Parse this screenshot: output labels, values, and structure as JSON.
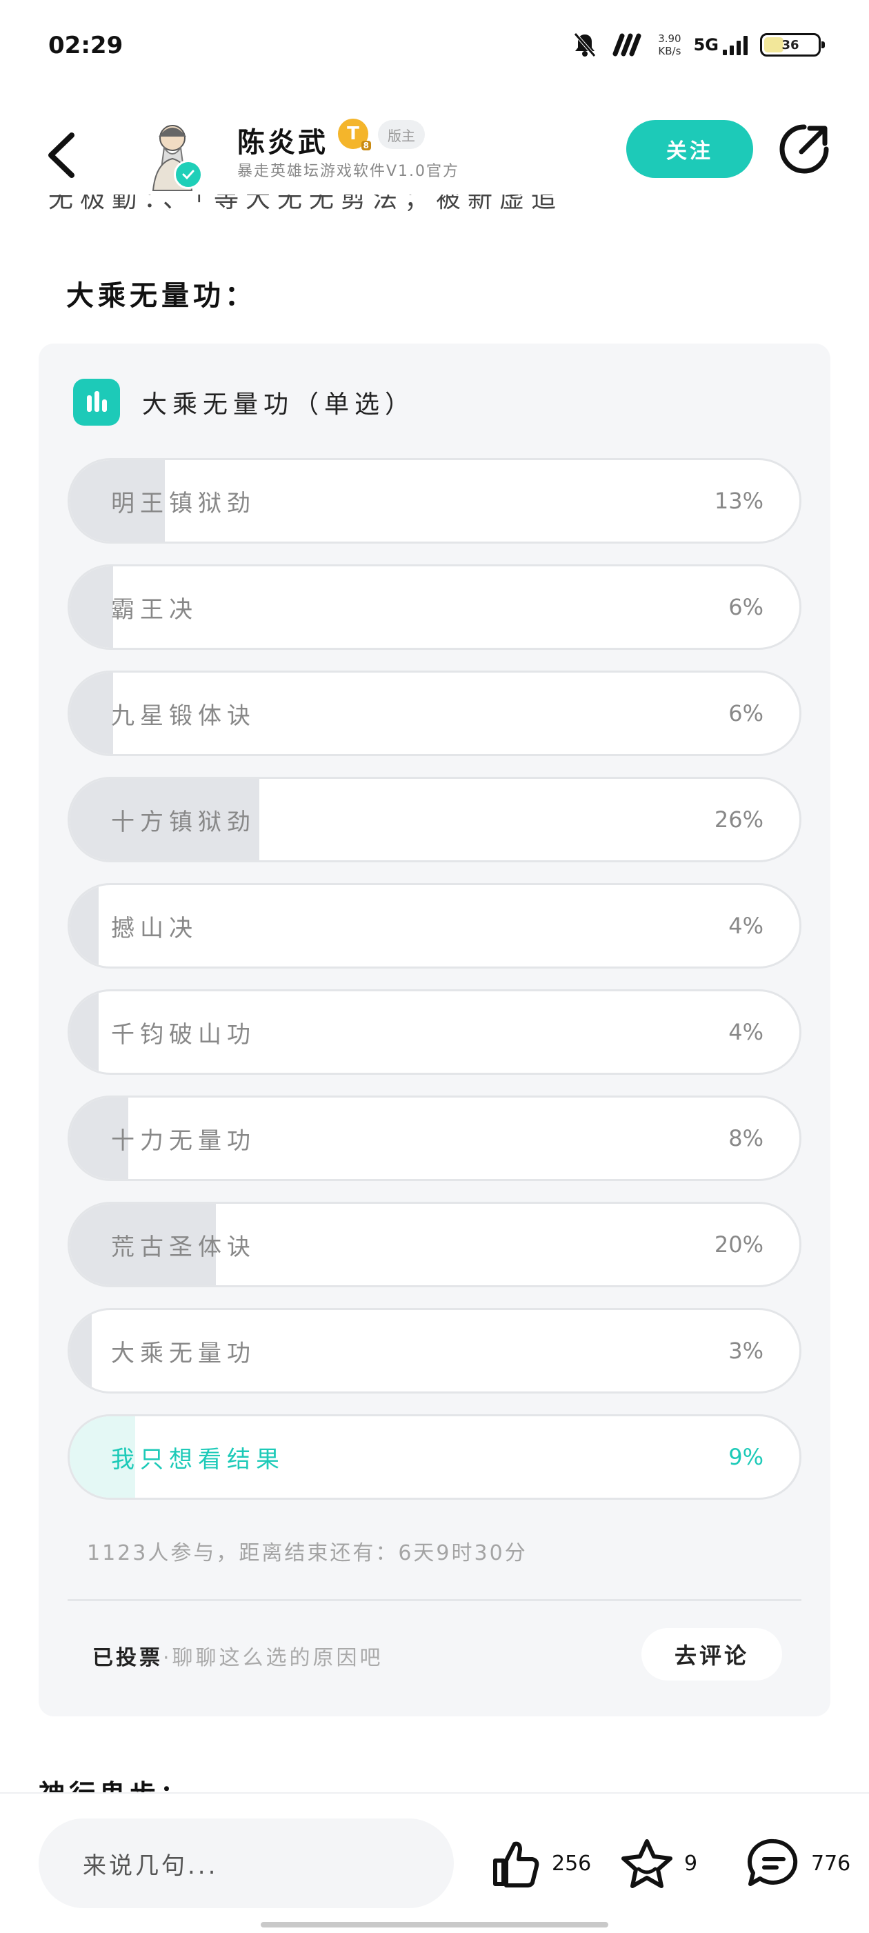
{
  "status_bar": {
    "time": "02:29",
    "net_speed_value": "3.90",
    "net_speed_unit": "KB/s",
    "network": "5G",
    "battery": "36"
  },
  "header": {
    "author_name": "陈炎武",
    "level_badge": "T",
    "level_sub": "8",
    "role_tag": "版主",
    "author_subtitle": "暴走英雄坛游戏软件V1.0官方",
    "follow_label": "关注",
    "icons": {
      "back": "chevron-left-icon",
      "share": "share-arrow-icon",
      "verified": "check-icon"
    }
  },
  "article": {
    "cut_text": "无极勤：、「等大无无剪法；被新虚追",
    "section_title": "大乘无量功："
  },
  "poll": {
    "title": "大乘无量功（单选）",
    "icon": "bar-chart-icon",
    "accent_color": "#1dcab8",
    "options": [
      {
        "label": "明王镇狱劲",
        "percent": "13%",
        "share": 0.13,
        "mine": false
      },
      {
        "label": "霸王决",
        "percent": "6%",
        "share": 0.06,
        "mine": false
      },
      {
        "label": "九星锻体诀",
        "percent": "6%",
        "share": 0.06,
        "mine": false
      },
      {
        "label": "十方镇狱劲",
        "percent": "26%",
        "share": 0.26,
        "mine": false
      },
      {
        "label": "撼山决",
        "percent": "4%",
        "share": 0.04,
        "mine": false
      },
      {
        "label": "千钧破山功",
        "percent": "4%",
        "share": 0.04,
        "mine": false
      },
      {
        "label": "十力无量功",
        "percent": "8%",
        "share": 0.08,
        "mine": false
      },
      {
        "label": "荒古圣体诀",
        "percent": "20%",
        "share": 0.2,
        "mine": false
      },
      {
        "label": "大乘无量功",
        "percent": "3%",
        "share": 0.03,
        "mine": false
      },
      {
        "label": "我只想看结果",
        "percent": "9%",
        "share": 0.09,
        "mine": true
      }
    ],
    "stats_text": "1123人参与，距离结束还有：6天9时30分",
    "voted_label": "已投票",
    "voted_prompt": "·聊聊这么选的原因吧",
    "comment_button": "去评论"
  },
  "next_section_title": "神行鬼步：",
  "bottom_bar": {
    "input_placeholder": "来说几句...",
    "likes": "256",
    "favorites": "9",
    "comments": "776",
    "icons": {
      "like": "thumbs-up-icon",
      "favorite": "star-icon",
      "comment": "chat-bubble-icon"
    }
  }
}
